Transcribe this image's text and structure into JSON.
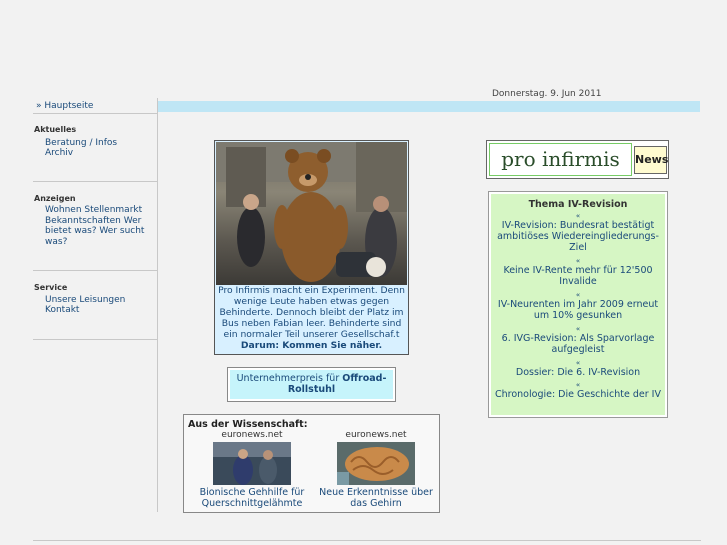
{
  "header": {
    "date": "Donnerstag. 9. Jun 2011"
  },
  "sidebar": {
    "home_label": "» Hauptseite",
    "sections": [
      {
        "title": "Aktuelles",
        "links": [
          "Beratung / Infos",
          "Archiv"
        ]
      },
      {
        "title": "Anzeigen",
        "links": [
          "Wohnen Stellenmarkt Bekanntschaften Wer bietet was? Wer sucht was?"
        ]
      },
      {
        "title": "Service",
        "links": [
          "Unsere Leisungen",
          "Kontakt"
        ]
      }
    ]
  },
  "feature": {
    "text": "Pro Infirmis macht ein Experiment. Denn wenige Leute haben etwas gegen Behinderte. Dennoch bleibt der Platz im Bus neben Fabian leer. Behinderte sind ein normaler Teil unserer Gesellschaf.t",
    "cta": "Darum: Kommen Sie näher."
  },
  "award": {
    "prefix": "Unternehmerpreis für ",
    "bold": "Offroad-Rollstuhl"
  },
  "science": {
    "title": "Aus der Wissenschaft:",
    "items": [
      {
        "source": "euronews.net",
        "caption": "Bionische Gehhilfe für Querschnittgelähmte"
      },
      {
        "source": "euronews.net",
        "caption": "Neue Erkenntnisse über das Gehirn"
      }
    ]
  },
  "logo": {
    "text": "pro infirmis",
    "news_label": "News"
  },
  "iv_box": {
    "title": "Thema IV-Revision",
    "arrow": "«",
    "items": [
      "IV-Revision: Bundesrat bestätigt ambitiöses Wiedereingliederungs-Ziel",
      "Keine IV-Rente mehr für 12'500 Invalide",
      "IV-Neurenten im Jahr 2009 erneut um 10% gesunken",
      "6. IVG-Revision: Als Sparvorlage aufgegleist",
      "Dossier: Die 6. IV-Revision",
      "Chronologie: Die Geschichte der IV"
    ]
  },
  "colors": {
    "topbar": "#bfe6f5",
    "link": "#1a4a7a",
    "iv_bg": "#d6f6c4",
    "award_bg": "#c6f4fb"
  }
}
